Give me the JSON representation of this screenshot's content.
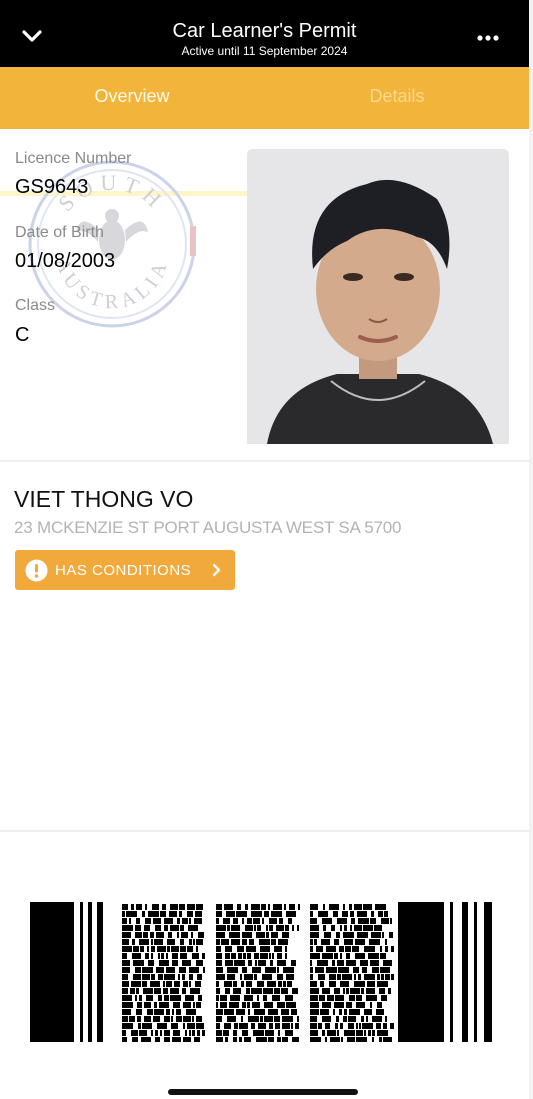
{
  "header": {
    "title": "Car Learner's Permit",
    "subtitle": "Active until 11 September 2024",
    "back_icon": "chevron-down-icon",
    "more_icon": "more-horizontal-icon"
  },
  "tabs": [
    {
      "label": "Overview",
      "active": true
    },
    {
      "label": "Details",
      "active": false
    }
  ],
  "licence": {
    "fields": [
      {
        "label": "Licence Number",
        "value": "GS9643"
      },
      {
        "label": "Date of Birth",
        "value": "01/08/2003"
      },
      {
        "label": "Class",
        "value": "C"
      }
    ],
    "seal_text_top": "SOUTH",
    "seal_text_bottom": "AUSTRALIA"
  },
  "holder": {
    "name": "VIET THONG VO",
    "address": "23 MCKENZIE ST PORT AUGUSTA WEST SA 5700"
  },
  "conditions_button": {
    "label": "HAS CONDITIONS",
    "icon": "alert-circle-icon",
    "chevron_icon": "chevron-right-icon"
  },
  "colors": {
    "header_bg": "#000000",
    "tab_bar_bg": "#f2b43a",
    "conditions_bg": "#f2a93b"
  }
}
